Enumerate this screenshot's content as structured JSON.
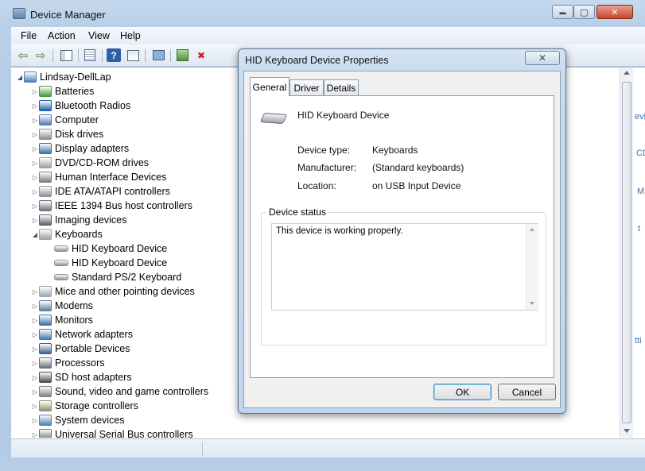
{
  "window": {
    "title": "Device Manager",
    "minimize_glyph": "▬",
    "maximize_glyph": "▢",
    "close_glyph": "✕"
  },
  "menu": [
    "File",
    "Action",
    "View",
    "Help"
  ],
  "toolbar": {
    "icons": [
      "back-arrow-icon",
      "forward-arrow-icon",
      "show-hide-tree-icon",
      "properties-icon",
      "help-icon",
      "view-icon",
      "scan-hardware-icon",
      "update-driver-icon",
      "uninstall-icon"
    ],
    "back_glyph": "⇦",
    "forward_glyph": "⇨",
    "help_glyph": "?"
  },
  "tree": {
    "root": "Lindsay-DellLap",
    "items": [
      {
        "label": "Batteries",
        "icon": "battery-icon",
        "color": "#4a9a3a"
      },
      {
        "label": "Bluetooth Radios",
        "icon": "bluetooth-icon",
        "color": "#1d5fa8"
      },
      {
        "label": "Computer",
        "icon": "computer-icon",
        "color": "#4d7fb8"
      },
      {
        "label": "Disk drives",
        "icon": "disk-drive-icon",
        "color": "#8a8f96"
      },
      {
        "label": "Display adapters",
        "icon": "display-adapter-icon",
        "color": "#3d6fa8"
      },
      {
        "label": "DVD/CD-ROM drives",
        "icon": "dvd-drive-icon",
        "color": "#9aa0a8"
      },
      {
        "label": "Human Interface Devices",
        "icon": "hid-icon",
        "color": "#7a7f86"
      },
      {
        "label": "IDE ATA/ATAPI controllers",
        "icon": "ide-controller-icon",
        "color": "#8e949c"
      },
      {
        "label": "IEEE 1394 Bus host controllers",
        "icon": "ieee1394-icon",
        "color": "#6e747c"
      },
      {
        "label": "Imaging devices",
        "icon": "camera-icon",
        "color": "#5a6068"
      },
      {
        "label": "Keyboards",
        "icon": "keyboard-icon",
        "color": "#9ca2a9",
        "expanded": true,
        "children": [
          "HID Keyboard Device",
          "HID Keyboard Device",
          "Standard PS/2 Keyboard"
        ]
      },
      {
        "label": "Mice and other pointing devices",
        "icon": "mouse-icon",
        "color": "#a0a6ad"
      },
      {
        "label": "Modems",
        "icon": "modem-icon",
        "color": "#5d7fa5"
      },
      {
        "label": "Monitors",
        "icon": "monitor-icon",
        "color": "#3f6ea6"
      },
      {
        "label": "Network adapters",
        "icon": "network-adapter-icon",
        "color": "#3f78b3"
      },
      {
        "label": "Portable Devices",
        "icon": "portable-device-icon",
        "color": "#3a5f8f"
      },
      {
        "label": "Processors",
        "icon": "processor-icon",
        "color": "#6a6f76"
      },
      {
        "label": "SD host adapters",
        "icon": "sd-adapter-icon",
        "color": "#4a4f56"
      },
      {
        "label": "Sound, video and game controllers",
        "icon": "speaker-icon",
        "color": "#7d8289"
      },
      {
        "label": "Storage controllers",
        "icon": "storage-controller-icon",
        "color": "#9a8f6a"
      },
      {
        "label": "System devices",
        "icon": "system-devices-icon",
        "color": "#4d7fb8"
      },
      {
        "label": "Universal Serial Bus controllers",
        "icon": "usb-icon",
        "color": "#6e747c"
      }
    ]
  },
  "dialog": {
    "title": "HID Keyboard Device Properties",
    "close_glyph": "✕",
    "tabs": [
      "General",
      "Driver",
      "Details"
    ],
    "device_name": "HID Keyboard Device",
    "properties": [
      {
        "label": "Device type:",
        "value": "Keyboards"
      },
      {
        "label": "Manufacturer:",
        "value": "(Standard keyboards)"
      },
      {
        "label": "Location:",
        "value": "on USB Input Device"
      }
    ],
    "status_legend": "Device status",
    "status_text": "This device is working properly.",
    "ok_label": "OK",
    "cancel_label": "Cancel"
  },
  "right_pane_fragments": [
    "evic",
    "CD",
    "M",
    "t",
    "tti"
  ]
}
